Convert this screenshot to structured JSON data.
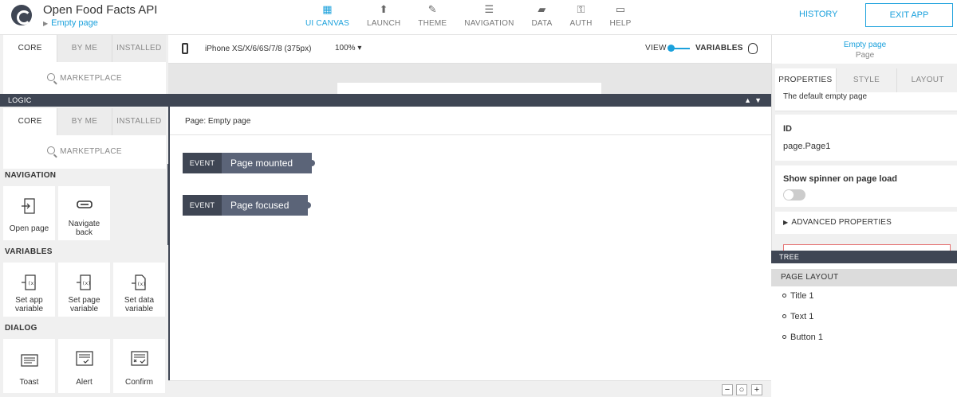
{
  "header": {
    "app_title": "Open Food Facts API",
    "page_name": "Empty page",
    "nav": [
      {
        "label": "UI CANVAS",
        "icon": "ui-canvas-icon",
        "active": true
      },
      {
        "label": "LAUNCH",
        "icon": "launch-icon",
        "active": false
      },
      {
        "label": "THEME",
        "icon": "theme-icon",
        "active": false
      },
      {
        "label": "NAVIGATION",
        "icon": "navigation-icon",
        "active": false
      },
      {
        "label": "DATA",
        "icon": "data-icon",
        "active": false
      },
      {
        "label": "AUTH",
        "icon": "auth-icon",
        "active": false
      },
      {
        "label": "HELP",
        "icon": "help-icon",
        "active": false
      }
    ],
    "history_label": "HISTORY",
    "exit_label": "EXIT APP"
  },
  "left": {
    "tabs": [
      "CORE",
      "BY ME",
      "INSTALLED"
    ],
    "marketplace": "MARKETPLACE",
    "sections": {
      "navigation": "NAVIGATION",
      "variables": "VARIABLES",
      "dialog": "DIALOG"
    },
    "tiles": {
      "open_page": "Open page",
      "navigate_back": "Navigate back",
      "set_app_variable": "Set app variable",
      "set_page_variable": "Set page variable",
      "set_data_variable": "Set data variable",
      "toast": "Toast",
      "alert": "Alert",
      "confirm": "Confirm"
    }
  },
  "canvas_toolbar": {
    "device": "iPhone XS/X/6/6S/7/8 (375px)",
    "zoom": "100%",
    "view_label": "VIEW",
    "variables_label": "VARIABLES"
  },
  "logic": {
    "bar_label": "LOGIC",
    "head": "Page: Empty page",
    "events": [
      {
        "tag": "EVENT",
        "name": "Page mounted"
      },
      {
        "tag": "EVENT",
        "name": "Page focused"
      }
    ],
    "zoom_controls": [
      "−",
      "○",
      "+"
    ]
  },
  "right": {
    "selected_name": "Empty page",
    "selected_type": "Page",
    "tabs": [
      "PROPERTIES",
      "STYLE",
      "LAYOUT"
    ],
    "description": "The default empty page",
    "id_label": "ID",
    "id_value": "page.Page1",
    "spinner_label": "Show spinner on page load",
    "advanced_label": "ADVANCED PROPERTIES",
    "tree_label": "TREE",
    "page_layout_label": "PAGE LAYOUT",
    "tree_items": [
      "Title 1",
      "Text 1",
      "Button 1"
    ]
  },
  "colors": {
    "accent": "#1ba1dc",
    "dark_bar": "#3f4654",
    "event_block": "#5b6478"
  }
}
